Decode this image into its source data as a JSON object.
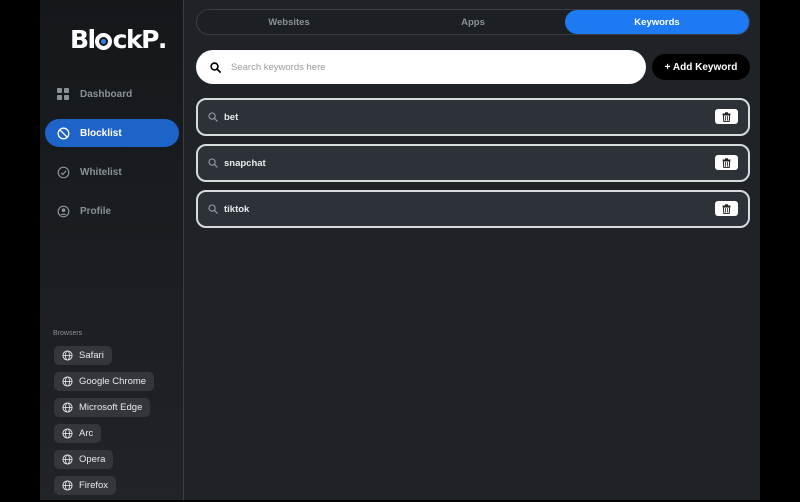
{
  "app": {
    "logo_prefix": "Bl",
    "logo_suffix": "ckP",
    "logo_dot": "."
  },
  "sidebar": {
    "items": [
      {
        "label": "Dashboard",
        "icon": "grid-icon",
        "active": false
      },
      {
        "label": "Blocklist",
        "icon": "block-icon",
        "active": true
      },
      {
        "label": "Whitelist",
        "icon": "check-circle-icon",
        "active": false
      },
      {
        "label": "Profile",
        "icon": "user-circle-icon",
        "active": false
      }
    ],
    "browsers_label": "Browsers",
    "browsers": [
      "Safari",
      "Google Chrome",
      "Microsoft Edge",
      "Arc",
      "Opera",
      "Firefox"
    ]
  },
  "tabs": [
    {
      "label": "Websites",
      "active": false
    },
    {
      "label": "Apps",
      "active": false
    },
    {
      "label": "Keywords",
      "active": true
    }
  ],
  "search": {
    "placeholder": "Search keywords here",
    "value": ""
  },
  "add_button": {
    "label": "+ Add Keyword"
  },
  "keywords": [
    "bet",
    "snapchat",
    "tiktok"
  ],
  "colors": {
    "accent": "#1d7af3",
    "active_nav": "#1e63c7",
    "background": "#1f2328"
  }
}
